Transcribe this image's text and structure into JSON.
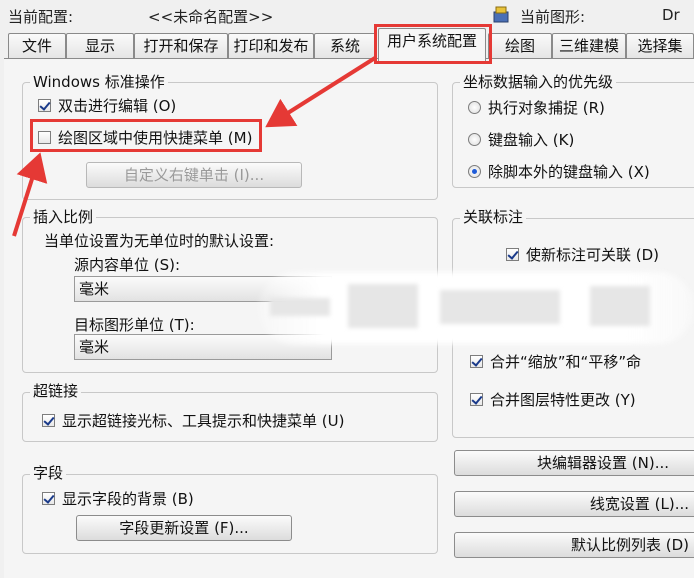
{
  "header": {
    "current_profile_label": "当前配置:",
    "current_profile_value": "<<未命名配置>>",
    "current_drawing_label": "当前图形:",
    "current_drawing_value": "Dr"
  },
  "tabs": [
    {
      "label": "文件"
    },
    {
      "label": "显示"
    },
    {
      "label": "打开和保存"
    },
    {
      "label": "打印和发布"
    },
    {
      "label": "系统"
    },
    {
      "label": "用户系统配置",
      "active": true
    },
    {
      "label": "绘图"
    },
    {
      "label": "三维建模"
    },
    {
      "label": "选择集"
    }
  ],
  "windows_ops": {
    "title": "Windows 标准操作",
    "double_click_edit": {
      "label": "双击进行编辑 (O)",
      "checked": true
    },
    "shortcut_menus": {
      "label": "绘图区域中使用快捷菜单 (M)",
      "checked": false
    },
    "right_click_button": "自定义右键单击 (I)..."
  },
  "insert_scale": {
    "title": "插入比例",
    "description": "当单位设置为无单位时的默认设置:",
    "source_label": "源内容单位 (S):",
    "source_value": "毫米",
    "target_label": "目标图形单位 (T):",
    "target_value": "毫米"
  },
  "hyperlink": {
    "title": "超链接",
    "option": {
      "label": "显示超链接光标、工具提示和快捷菜单 (U)",
      "checked": true
    }
  },
  "fields": {
    "title": "字段",
    "option": {
      "label": "显示字段的背景 (B)",
      "checked": true
    },
    "update_button": "字段更新设置 (F)..."
  },
  "coord_priority": {
    "title": "坐标数据输入的优先级",
    "options": [
      {
        "label": "执行对象捕捉 (R)",
        "checked": false
      },
      {
        "label": "键盘输入 (K)",
        "checked": false
      },
      {
        "label": "除脚本外的键盘输入 (X)",
        "checked": true
      }
    ]
  },
  "assoc_dim": {
    "title": "关联标注",
    "option": {
      "label": "使新标注可关联 (D)",
      "checked": true
    }
  },
  "undo": {
    "combine_zoom_pan": {
      "label": "合并“缩放”和“平移”命",
      "checked": true
    },
    "combine_layer": {
      "label": "合并图层特性更改 (Y)",
      "checked": true
    }
  },
  "right_buttons": {
    "block_editor": "块编辑器设置 (N)...",
    "lineweight": "线宽设置 (L)...",
    "default_scale": "默认比例列表 (D)"
  },
  "colors": {
    "highlight": "#e53935",
    "background": "#f0f0f0"
  }
}
